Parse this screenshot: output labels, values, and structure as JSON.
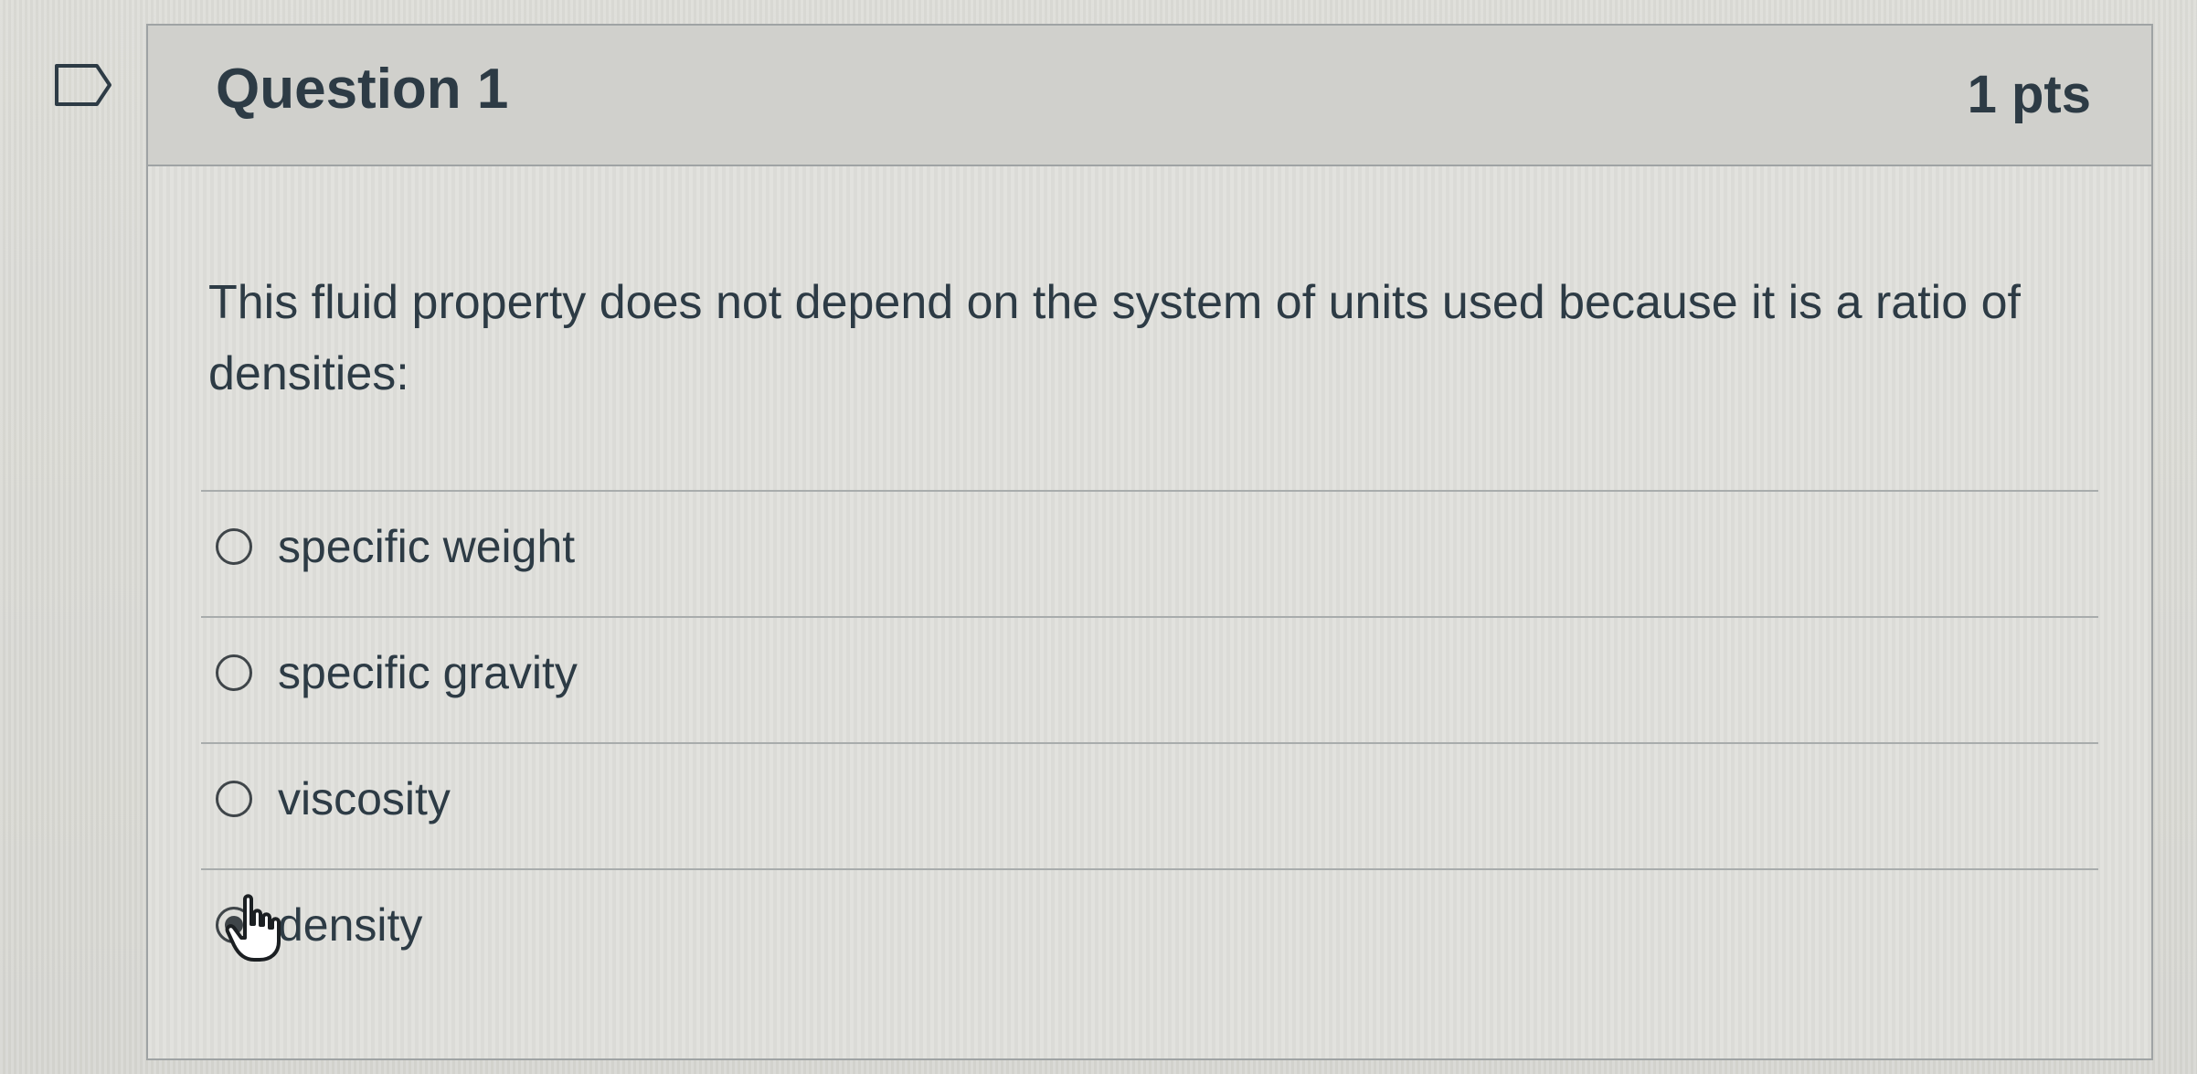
{
  "question": {
    "title": "Question 1",
    "points": "1 pts",
    "text": "This fluid property does not depend on the system of units used because it is a ratio of densities:"
  },
  "answers": [
    {
      "label": "specific weight",
      "selected": false
    },
    {
      "label": "specific gravity",
      "selected": false
    },
    {
      "label": "viscosity",
      "selected": false
    },
    {
      "label": "density",
      "selected": true
    }
  ],
  "icons": {
    "bookmark": "bookmark-flag-icon",
    "cursor": "hand-pointer-cursor-icon"
  },
  "colors": {
    "text": "#2d3b45",
    "border": "#9fa3a4",
    "header": "#d0d0cc",
    "background": "#dededa"
  }
}
